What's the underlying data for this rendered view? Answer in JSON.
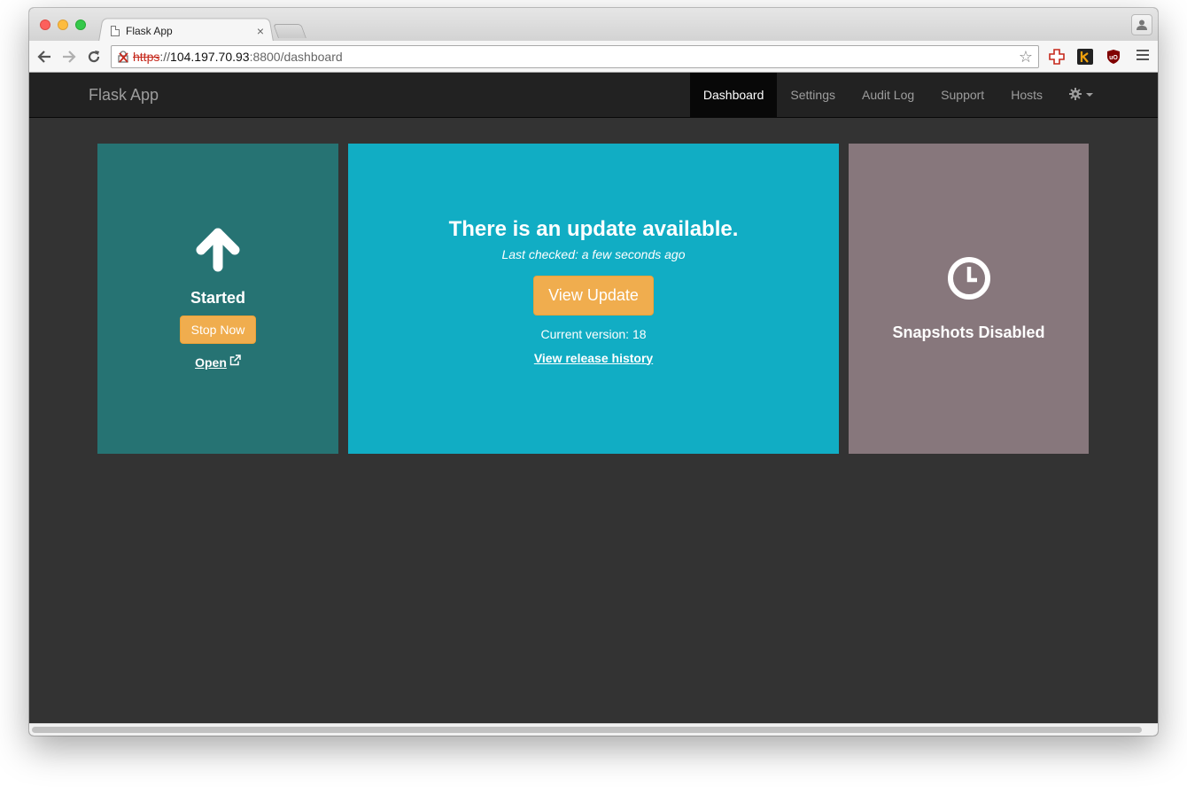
{
  "browser": {
    "tab_title": "Flask App",
    "tab_close": "×",
    "url": {
      "scheme": "https",
      "sep": "://",
      "host": "104.197.70.93",
      "path": ":8800/dashboard"
    },
    "icons": [
      "back-icon",
      "forward-icon",
      "reload-icon",
      "insecure-lock-icon",
      "bookmark-star-icon",
      "extension-icon",
      "menu-icon",
      "profile-icon"
    ]
  },
  "app": {
    "brand": "Flask App",
    "nav": [
      {
        "label": "Dashboard",
        "active": true
      },
      {
        "label": "Settings",
        "active": false
      },
      {
        "label": "Audit Log",
        "active": false
      },
      {
        "label": "Support",
        "active": false
      },
      {
        "label": "Hosts",
        "active": false
      }
    ]
  },
  "status_panel": {
    "icon": "arrow-up-icon",
    "title": "Started",
    "stop_button": "Stop Now",
    "open_link": "Open",
    "color": "#267373"
  },
  "update_panel": {
    "title": "There is an update available.",
    "last_checked": "Last checked: a few seconds ago",
    "view_button": "View Update",
    "current_version": "Current version: 18",
    "history_link": "View release history",
    "color": "#11adc4"
  },
  "snapshot_panel": {
    "icon": "clock-icon",
    "title": "Snapshots Disabled",
    "color": "#87777c"
  },
  "colors": {
    "navbar_bg": "#222222",
    "page_bg": "#333333",
    "button_warning": "#f0ad4e"
  }
}
